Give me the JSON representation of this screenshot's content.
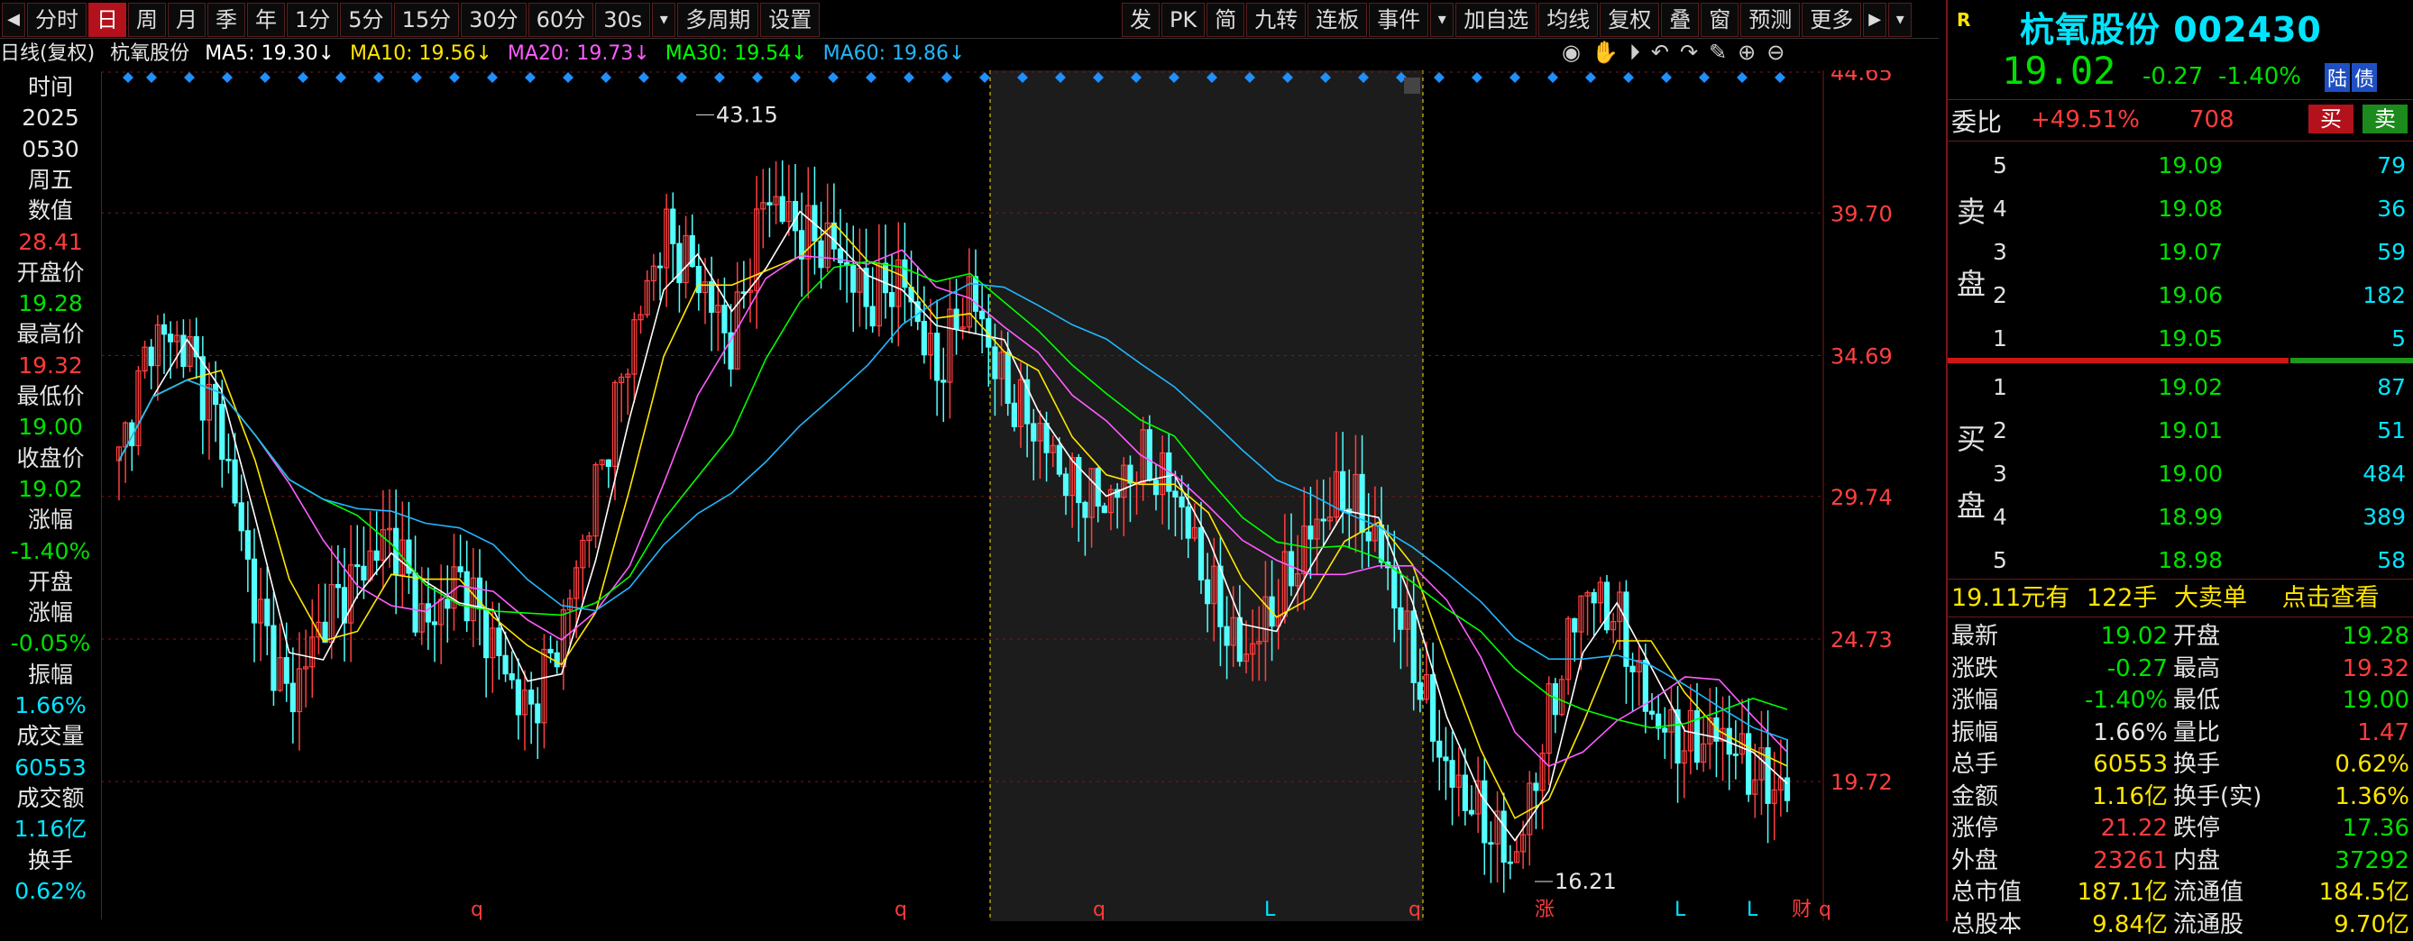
{
  "toolbar": {
    "left_items": [
      "分时",
      "日",
      "周",
      "月",
      "季",
      "年",
      "1分",
      "5分",
      "15分",
      "30分",
      "60分",
      "30s",
      "▾",
      "多周期",
      "设置"
    ],
    "active_index": 1,
    "right_items": [
      "发",
      "PK",
      "简",
      "九转",
      "连板",
      "事件",
      "▾",
      "加自选",
      "均线",
      "复权",
      "叠",
      "窗",
      "预测",
      "更多",
      "▶",
      "▾"
    ]
  },
  "ma_bar": {
    "period_label": "日线(复权)",
    "stock_name": "杭氧股份",
    "ma5": "MA5: 19.30↓",
    "ma10": "MA10: 19.56↓",
    "ma20": "MA20: 19.73↓",
    "ma30": "MA30: 19.54↓",
    "ma60": "MA60: 19.86↓",
    "colors": {
      "ma5": "#ffffff",
      "ma10": "#ffe600",
      "ma20": "#ff5cff",
      "ma30": "#00ff00",
      "ma60": "#22b7ff"
    }
  },
  "left_info": [
    {
      "text": "时间",
      "color": "#e6e6e6"
    },
    {
      "text": "2025",
      "color": "#e6e6e6"
    },
    {
      "text": "0530",
      "color": "#e6e6e6"
    },
    {
      "text": "周五",
      "color": "#e6e6e6"
    },
    {
      "text": "数值",
      "color": "#e6e6e6"
    },
    {
      "text": "28.41",
      "color": "#ff3b3b"
    },
    {
      "text": "开盘价",
      "color": "#e6e6e6"
    },
    {
      "text": "19.28",
      "color": "#00e000"
    },
    {
      "text": "最高价",
      "color": "#e6e6e6"
    },
    {
      "text": "19.32",
      "color": "#ff3b3b"
    },
    {
      "text": "最低价",
      "color": "#e6e6e6"
    },
    {
      "text": "19.00",
      "color": "#00e000"
    },
    {
      "text": "收盘价",
      "color": "#e6e6e6"
    },
    {
      "text": "19.02",
      "color": "#00e000"
    },
    {
      "text": "涨幅",
      "color": "#e6e6e6"
    },
    {
      "text": "-1.40%",
      "color": "#00e000"
    },
    {
      "text": "开盘",
      "color": "#e6e6e6"
    },
    {
      "text": "涨幅",
      "color": "#e6e6e6"
    },
    {
      "text": "-0.05%",
      "color": "#00e000"
    },
    {
      "text": "振幅",
      "color": "#e6e6e6"
    },
    {
      "text": "1.66%",
      "color": "#00e5ff"
    },
    {
      "text": "成交量",
      "color": "#e6e6e6"
    },
    {
      "text": "60553",
      "color": "#00e5ff"
    },
    {
      "text": "成交额",
      "color": "#e6e6e6"
    },
    {
      "text": "1.16亿",
      "color": "#00e5ff"
    },
    {
      "text": "换手",
      "color": "#e6e6e6"
    },
    {
      "text": "0.62%",
      "color": "#00e5ff"
    }
  ],
  "chart": {
    "price_axis": [
      "44.65",
      "39.70",
      "34.69",
      "29.74",
      "24.73",
      "19.72"
    ],
    "high_label": "43.15",
    "low_label": "16.21",
    "bottom_markers": [
      "q",
      "q",
      "q",
      "L",
      "q",
      "涨",
      "L",
      "L",
      "财",
      "q"
    ],
    "colors": {
      "up": "#ff4040",
      "down": "#54ffff",
      "grid": "#7a1a1a",
      "axis_text": "#ff4040"
    }
  },
  "chart_data": {
    "type": "line",
    "title": "杭氧股份 日线(复权)",
    "xlabel": "",
    "ylabel": "",
    "ylim": [
      16.21,
      44.65
    ],
    "ma_latest": {
      "MA5": 19.3,
      "MA10": 19.56,
      "MA20": 19.73,
      "MA30": 19.54,
      "MA60": 19.86
    },
    "period_high": 43.15,
    "period_low": 16.21,
    "last_close": 19.02,
    "series": [
      {
        "name": "MA5",
        "values": [
          31,
          35.5,
          35,
          32,
          26,
          22.5,
          25.5,
          27,
          28.5,
          25,
          27,
          24.5,
          22,
          25,
          30,
          35,
          39,
          37.5,
          35,
          40.5,
          39,
          38.5,
          36.5,
          37.5,
          34,
          37,
          33.5,
          32,
          30,
          29.5,
          31,
          30,
          26.5,
          24,
          26,
          28.5,
          30,
          28,
          24,
          20,
          18.5,
          16.8,
          22,
          26.5,
          25.5,
          22,
          21,
          21.5,
          20,
          19.3
        ]
      }
    ]
  },
  "right_panel": {
    "badge": "R",
    "title": "杭氧股份 002430",
    "price": "19.02",
    "change": "-0.27",
    "change_pct": "-1.40%",
    "market_tags": [
      "陆",
      "债"
    ],
    "weibi_label": "委比",
    "weibi_value": "+49.51%",
    "weicha_value": "708",
    "buy_btn": "买",
    "sell_btn": "卖",
    "sell_side_label": [
      "卖",
      "盘"
    ],
    "buy_side_label": [
      "买",
      "盘"
    ],
    "asks": [
      {
        "lvl": "5",
        "price": "19.09",
        "vol": "79"
      },
      {
        "lvl": "4",
        "price": "19.08",
        "vol": "36"
      },
      {
        "lvl": "3",
        "price": "19.07",
        "vol": "59"
      },
      {
        "lvl": "2",
        "price": "19.06",
        "vol": "182"
      },
      {
        "lvl": "1",
        "price": "19.05",
        "vol": "5"
      }
    ],
    "bids": [
      {
        "lvl": "1",
        "price": "19.02",
        "vol": "87"
      },
      {
        "lvl": "2",
        "price": "19.01",
        "vol": "51"
      },
      {
        "lvl": "3",
        "price": "19.00",
        "vol": "484"
      },
      {
        "lvl": "4",
        "price": "18.99",
        "vol": "389"
      },
      {
        "lvl": "5",
        "price": "18.98",
        "vol": "58"
      }
    ],
    "big_order": {
      "price": "19.11元有",
      "qty": "122手",
      "type": "大卖单",
      "link": "点击查看"
    },
    "quotes": [
      {
        "l": "最新",
        "v": "19.02",
        "c": "#00e000",
        "l2": "开盘",
        "v2": "19.28",
        "c2": "#00e000"
      },
      {
        "l": "涨跌",
        "v": "-0.27",
        "c": "#00e000",
        "l2": "最高",
        "v2": "19.32",
        "c2": "#ff3b3b"
      },
      {
        "l": "涨幅",
        "v": "-1.40%",
        "c": "#00e000",
        "l2": "最低",
        "v2": "19.00",
        "c2": "#00e000"
      },
      {
        "l": "振幅",
        "v": "1.66%",
        "c": "#e6e6e6",
        "l2": "量比",
        "v2": "1.47",
        "c2": "#ff3b3b"
      },
      {
        "l": "总手",
        "v": "60553",
        "c": "#ffe600",
        "l2": "换手",
        "v2": "0.62%",
        "c2": "#ffe600"
      },
      {
        "l": "金额",
        "v": "1.16亿",
        "c": "#ffe600",
        "l2": "换手(实)",
        "v2": "1.36%",
        "c2": "#ffe600"
      },
      {
        "l": "涨停",
        "v": "21.22",
        "c": "#ff3b3b",
        "l2": "跌停",
        "v2": "17.36",
        "c2": "#00e000"
      },
      {
        "l": "外盘",
        "v": "23261",
        "c": "#ff3b3b",
        "l2": "内盘",
        "v2": "37292",
        "c2": "#00e000"
      },
      {
        "l": "总市值",
        "v": "187.1亿",
        "c": "#ffe600",
        "l2": "流通值",
        "v2": "184.5亿",
        "c2": "#ffe600"
      },
      {
        "l": "总股本",
        "v": "9.84亿",
        "c": "#ffe600",
        "l2": "流通股",
        "v2": "9.70亿",
        "c2": "#ffe600"
      }
    ]
  }
}
